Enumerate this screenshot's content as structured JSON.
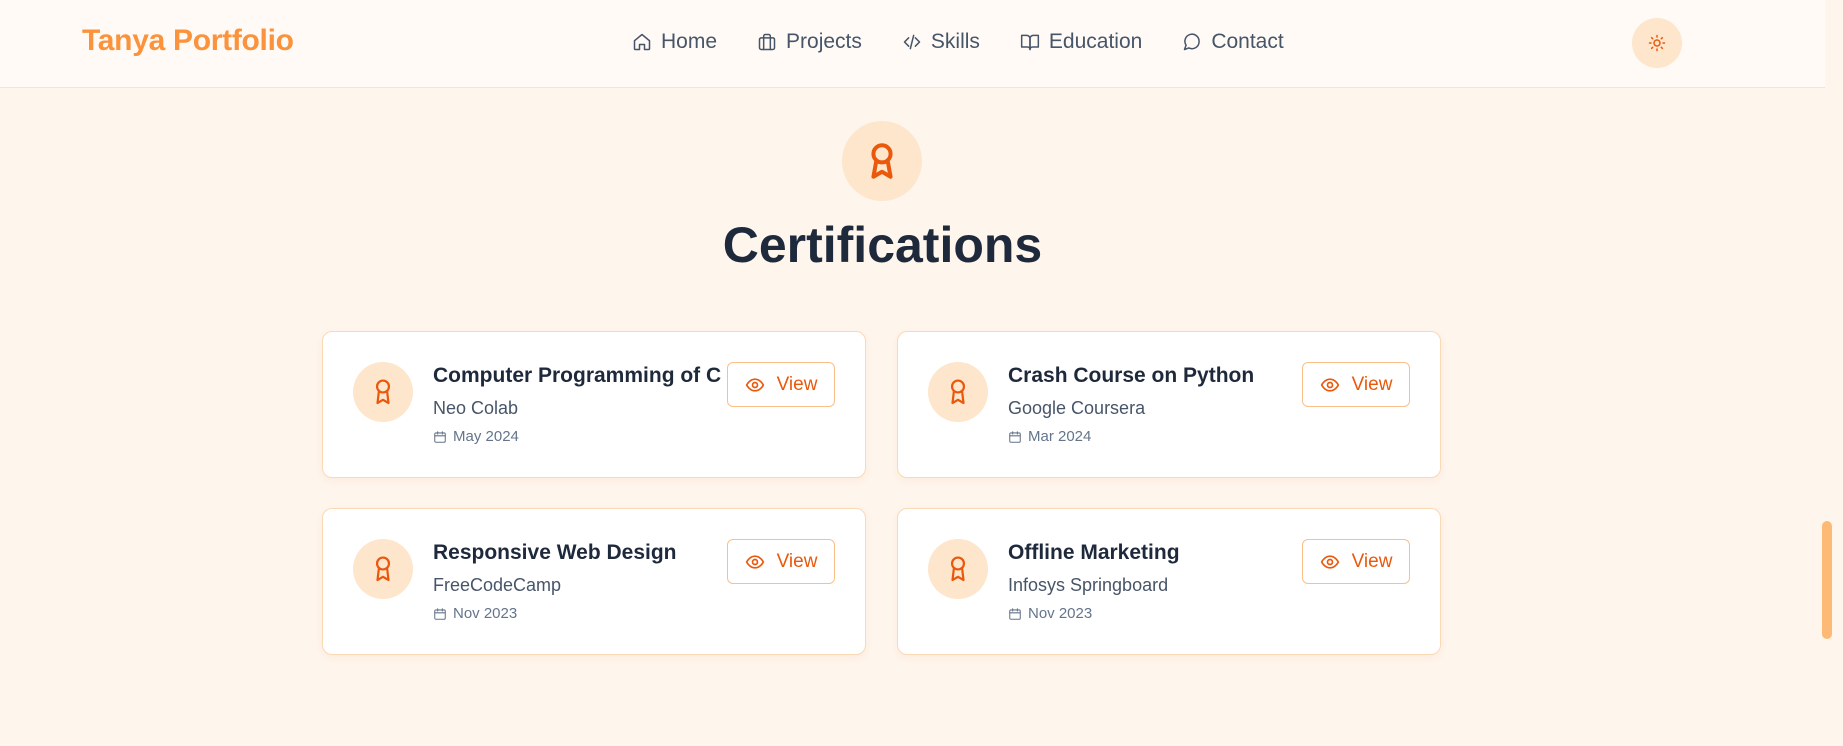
{
  "header": {
    "brand": "Tanya Portfolio",
    "nav": [
      {
        "label": "Home",
        "icon": "home-icon"
      },
      {
        "label": "Projects",
        "icon": "briefcase-icon"
      },
      {
        "label": "Skills",
        "icon": "code-icon"
      },
      {
        "label": "Education",
        "icon": "book-icon"
      },
      {
        "label": "Contact",
        "icon": "message-icon"
      }
    ],
    "theme_toggle_icon": "sun-icon"
  },
  "section": {
    "icon": "award-icon",
    "title": "Certifications"
  },
  "certifications": [
    {
      "title": "Computer Programming of C",
      "issuer": "Neo Colab",
      "date": "May 2024",
      "button": "View"
    },
    {
      "title": "Crash Course on Python",
      "issuer": "Google Coursera",
      "date": "Mar 2024",
      "button": "View"
    },
    {
      "title": "Responsive Web Design",
      "issuer": "FreeCodeCamp",
      "date": "Nov 2023",
      "button": "View"
    },
    {
      "title": "Offline Marketing",
      "issuer": "Infosys Springboard",
      "date": "Nov 2023",
      "button": "View"
    }
  ],
  "colors": {
    "accent": "#ea580c",
    "brand": "#fb923c",
    "background": "#fef5ec",
    "badge_bg": "#fde6cc"
  }
}
